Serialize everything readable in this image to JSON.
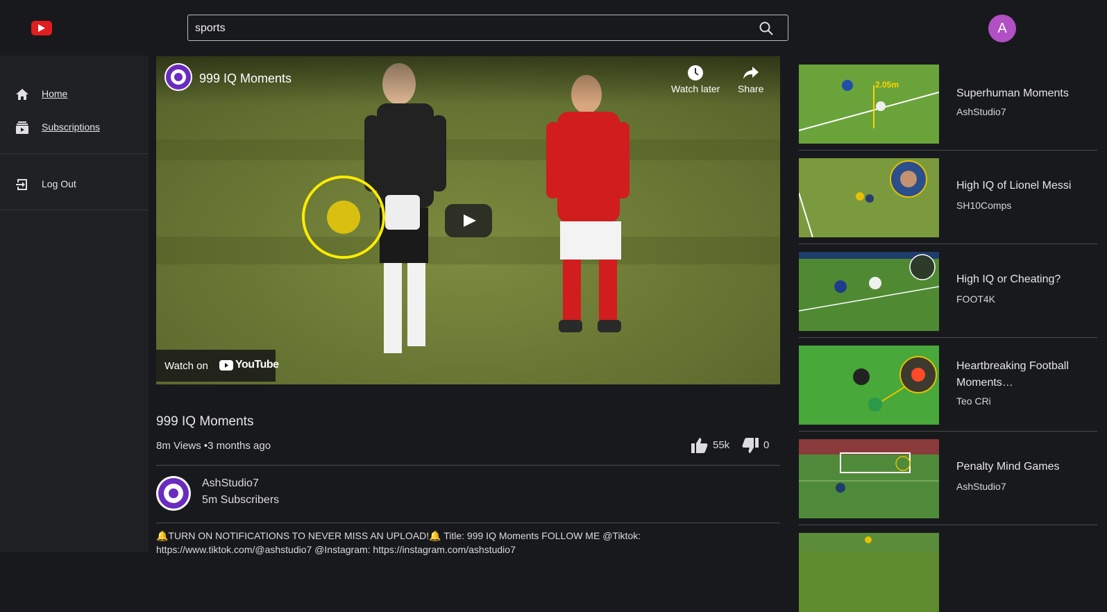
{
  "colors": {
    "background": "#18191c",
    "sidebar": "#202124",
    "brand_red": "#e01e1e",
    "avatar": "#b14fc5"
  },
  "header": {
    "logo_icon": "youtube-logo-icon",
    "search": {
      "value": "sports",
      "icon": "search-icon"
    },
    "avatar_letter": "A"
  },
  "sidebar": {
    "items": [
      {
        "label": "Home",
        "icon": "home-icon"
      },
      {
        "label": "Subscriptions",
        "icon": "subscriptions-icon"
      },
      {
        "label": "Log Out",
        "icon": "logout-icon"
      }
    ]
  },
  "player": {
    "title": "999 IQ Moments",
    "watch_later": "Watch later",
    "share": "Share",
    "watch_on": "Watch on",
    "youtube_word": "YouTube"
  },
  "video": {
    "title": "999 IQ Moments",
    "meta": "8m Views •3 months ago",
    "likes": "55k",
    "dislikes": "0",
    "channel": {
      "name": "AshStudio7",
      "subscribers": "5m Subscribers"
    },
    "description": "🔔TURN ON NOTIFICATIONS TO NEVER MISS AN UPLOAD!🔔 Title: 999 IQ Moments FOLLOW ME @Tiktok: https://www.tiktok.com/@ashstudio7 @Instagram: https://instagram.com/ashstudio7"
  },
  "recommendations": [
    {
      "title": "Superhuman Moments",
      "channel": "AshStudio7",
      "thumb_label": "2.05m"
    },
    {
      "title": "High IQ of Lionel Messi",
      "channel": "SH10Comps"
    },
    {
      "title": "High IQ or Cheating?",
      "channel": "FOOT4K"
    },
    {
      "title": "Heartbreaking Football Moments…",
      "channel": "Teo CRi"
    },
    {
      "title": "Penalty Mind Games",
      "channel": "AshStudio7"
    }
  ]
}
